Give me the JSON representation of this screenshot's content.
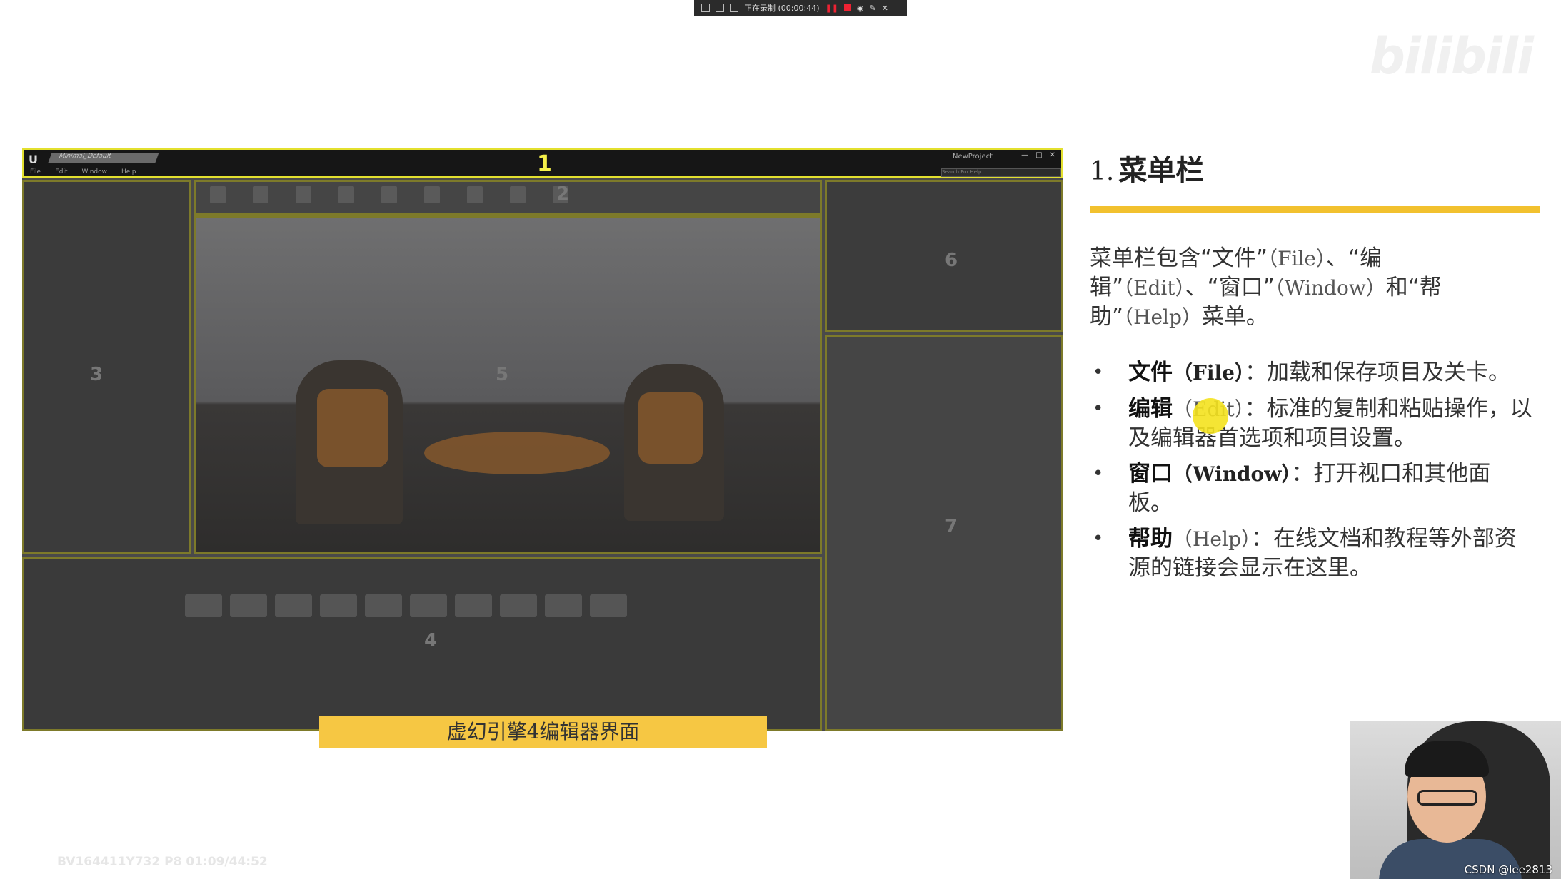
{
  "recording_bar": {
    "status": "正在录制 (00:00:44)"
  },
  "bilibili_logo": "bilibili",
  "editor_screenshot": {
    "menu_items": [
      "File",
      "Edit",
      "Window",
      "Help"
    ],
    "tab_label": "Minimal_Default",
    "project_name": "NewProject",
    "search_placeholder": "Search For Help",
    "panel_numbers": {
      "menu": "1",
      "toolbar": "2",
      "modes": "3",
      "content": "4",
      "viewport": "5",
      "outliner": "6",
      "details": "7"
    }
  },
  "caption": "虚幻引擎4编辑器界面",
  "section": {
    "number": "1.",
    "title": "菜单栏",
    "intro_parts": [
      "菜单栏包含“文件”",
      "（File）",
      "、“编辑”",
      "（Edit）",
      "、“窗口”",
      "（Window）",
      "和“帮助”",
      "（Help）",
      "菜单。"
    ],
    "items": [
      {
        "term": "文件",
        "en": "（File）",
        "desc": "：加载和保存项目及关卡。"
      },
      {
        "term": "编辑",
        "en": "（Edit）",
        "desc": "：标准的复制和粘贴操作，以及编辑器首选项和项目设置。"
      },
      {
        "term": "窗口",
        "en": "（Window）",
        "desc": "：打开视口和其他面板。"
      },
      {
        "term": "帮助",
        "en": "（Help）",
        "desc": "：在线文档和教程等外部资源的链接会显示在这里。"
      }
    ]
  },
  "video_id": "BV164411Y732 P8 01:09/44:52",
  "watermark": "CSDN @lee2813",
  "colors": {
    "highlight": "#e3e02f",
    "accent_bar": "#f2c12e",
    "caption_bg": "#f6c743"
  }
}
